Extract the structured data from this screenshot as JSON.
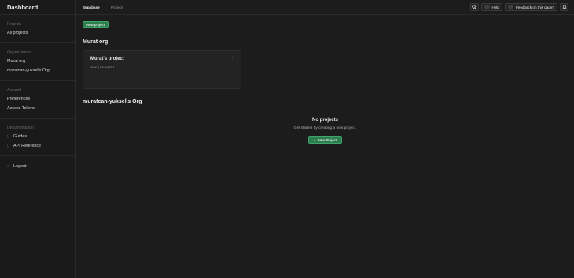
{
  "sidebar": {
    "title": "Dashboard",
    "sections": [
      {
        "heading": "Projects",
        "items": [
          {
            "label": "All projects"
          }
        ]
      },
      {
        "heading": "Organizations",
        "items": [
          {
            "label": "Murat org"
          },
          {
            "label": "muratcan-yuksel's Org"
          }
        ]
      },
      {
        "heading": "Account",
        "items": [
          {
            "label": "Preferences"
          },
          {
            "label": "Access Tokens"
          }
        ]
      },
      {
        "heading": "Documentation",
        "items": [
          {
            "label": "Guides",
            "icon": "book-icon"
          },
          {
            "label": "API Reference",
            "icon": "book-icon"
          }
        ]
      }
    ],
    "logout": {
      "label": "Logout",
      "icon": "logout-icon"
    }
  },
  "header": {
    "nav": [
      "Supabase",
      "Projects"
    ],
    "help_label": "Help",
    "feedback_label": "Feedback on this page?"
  },
  "main": {
    "new_project_label": "New project",
    "orgs": [
      {
        "name": "Murat org",
        "project": {
          "name": "Murat's project",
          "region": "aws | us-east-1"
        }
      },
      {
        "name": "muratcan-yuksel's Org",
        "empty_title": "No projects",
        "empty_sub": "Get started by creating a new project.",
        "button_label": "New Project"
      }
    ]
  },
  "colors": {
    "accent": "#2e7d4f",
    "background": "#1c1c1c"
  }
}
